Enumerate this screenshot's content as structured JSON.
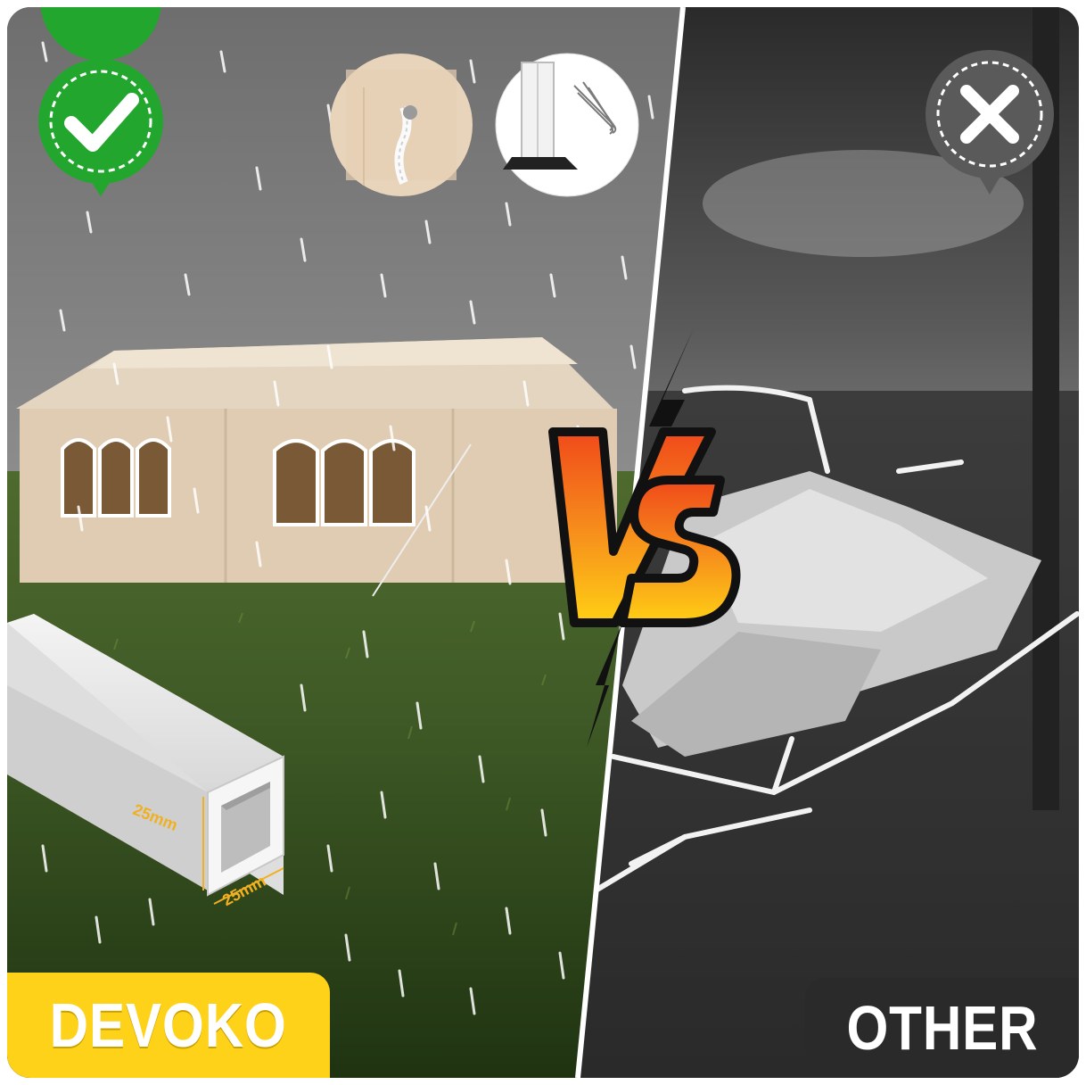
{
  "labels": {
    "left_brand": "DEVOKO",
    "right_brand": "OTHER",
    "versus": "VS"
  },
  "dimensions": {
    "height": "25mm",
    "width": "25mm"
  },
  "icons": {
    "good": "checkmark-icon",
    "bad": "cross-icon"
  },
  "colors": {
    "accent_yellow": "#ffd21a",
    "check_green": "#22a62e",
    "vs_orange": "#f46a1a",
    "vs_yellow": "#ffcc16"
  }
}
